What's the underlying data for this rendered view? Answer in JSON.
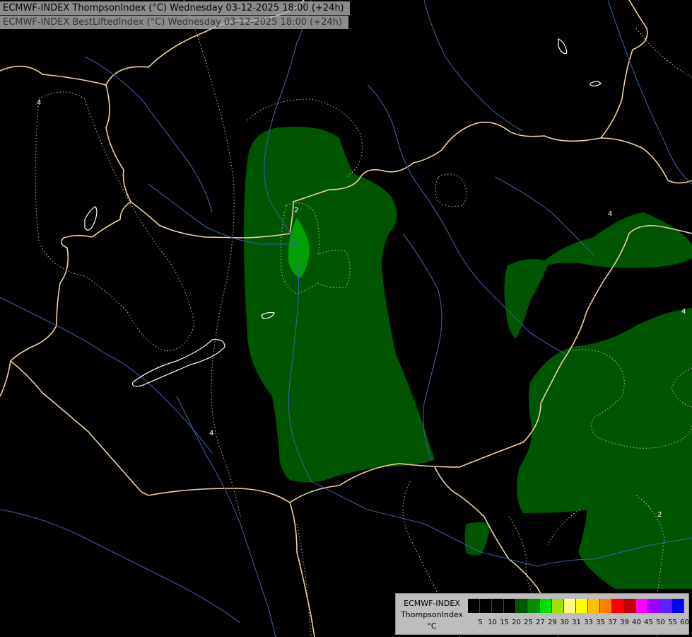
{
  "header": {
    "title_primary": "ECMWF-INDEX ThompsonIndex (°C) Wednesday 03-12-2025 18:00 (+24h)",
    "title_secondary": "ECMWF-INDEX BestLiftedIndex (°C) Wednesday 03-12-2025 18:00 (+24h)"
  },
  "map": {
    "contour_labels": [
      "4",
      "4",
      "2",
      "4",
      "4",
      "2"
    ],
    "colors": {
      "background": "#000000",
      "border": "#f5d0a0",
      "river": "#3c5ca8",
      "field_dark_green": "#005500",
      "field_green": "#00a000",
      "contour": "#b4b4b4"
    }
  },
  "legend": {
    "model": "ECMWF-INDEX",
    "parameter": "ThompsonIndex",
    "unit": "°C",
    "values": [
      "5",
      "10",
      "15",
      "20",
      "25",
      "27",
      "29",
      "30",
      "31",
      "33",
      "35",
      "37",
      "39",
      "40",
      "45",
      "50",
      "55",
      "60"
    ],
    "colors": [
      "#000000",
      "#000000",
      "#000000",
      "#000000",
      "#005500",
      "#009000",
      "#00e000",
      "#a0e000",
      "#ffff80",
      "#ffff00",
      "#ffc000",
      "#ff8000",
      "#ff0000",
      "#c00000",
      "#ff00ff",
      "#a000ff",
      "#6020ff",
      "#0000ff"
    ]
  }
}
